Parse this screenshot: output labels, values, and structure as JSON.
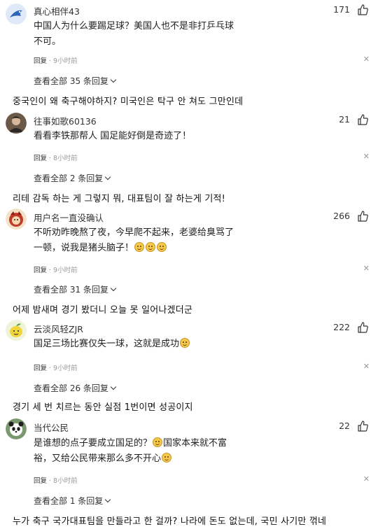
{
  "comments": [
    {
      "username": "真心相伴43",
      "likes": "171",
      "text_lines": [
        "中国人为什么要踢足球？美国人也不是非打乒乓球",
        "不可。"
      ],
      "reply_label": "回复",
      "time": "9小时前",
      "view_replies": "查看全部 35 条回复",
      "translation": "중국인이 왜 축구해야하지? 미국인은 탁구 안 쳐도 그만인데",
      "avatar_icon": "bird-avatar-icon"
    },
    {
      "username": "往事如歌60136",
      "likes": "21",
      "text_lines": [
        "看看李铁那帮人 国足能好倒是奇迹了！"
      ],
      "reply_label": "回复",
      "time": "8小时前",
      "view_replies": "查看全部 2 条回复",
      "translation": "리테 감독 하는 게 그렇지 뭐, 대표팀이 잘 하는게 기적!",
      "avatar_icon": "portrait-avatar-icon"
    },
    {
      "username": "用户名一直没确认",
      "likes": "266",
      "text_lines": [
        "不听劝昨晚熬了夜，今早爬不起来，老婆给臭骂了",
        "一顿，说我是猪头脑子！"
      ],
      "emoji_count": 3,
      "reply_label": "回复",
      "time": "9小时前",
      "view_replies": "查看全部 31 条回复",
      "translation": "어제 밤새며 경기 봤더니 오늘 못 일어나겠더군",
      "avatar_icon": "red-character-avatar-icon"
    },
    {
      "username": "云淡风轻ZJR",
      "likes": "222",
      "text_lines": [
        "国足三场比赛仅失一球，这就是成功"
      ],
      "emoji_count": 1,
      "reply_label": "回复",
      "time": "9小时前",
      "view_replies": "查看全部 26 条回复",
      "translation": "경기 세 번 치르는 동안 실점 1번이면 성공이지",
      "avatar_icon": "lemon-avatar-icon"
    },
    {
      "username": "当代公民",
      "likes": "22",
      "text_line1_a": "是谁想的点子要成立国足的？",
      "text_line1_b": "国家本来就不富",
      "text_line2": "裕，又给公民带来那么多不开心",
      "reply_label": "回复",
      "time": "8小时前",
      "view_replies": "查看全部 1 条回复",
      "translation": "누가 축구 국가대표팀을 만들라고 한 걸까? 나라에 돈도 없는데, 국민 사기만 꺾네",
      "avatar_icon": "panda-avatar-icon"
    }
  ],
  "icons": {
    "like": "thumbs-up-icon",
    "close": "close-icon",
    "chevron": "chevron-down-icon"
  },
  "close_glyph": "✕"
}
